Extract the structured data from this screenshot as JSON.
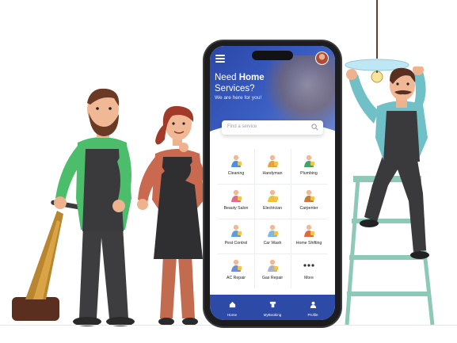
{
  "app": {
    "hero_title_line1_a": "Need ",
    "hero_title_line1_b": "Home",
    "hero_title_line2": "Services?",
    "hero_subtitle": "We are here for you!",
    "search_placeholder": "Find a service"
  },
  "services": [
    {
      "label": "Cleaning",
      "icon": "cleaning-icon"
    },
    {
      "label": "Handyman",
      "icon": "handyman-icon"
    },
    {
      "label": "Plumbing",
      "icon": "plumbing-icon"
    },
    {
      "label": "Beauty Salon",
      "icon": "beauty-salon-icon"
    },
    {
      "label": "Electrician",
      "icon": "electrician-icon"
    },
    {
      "label": "Carpenter",
      "icon": "carpenter-icon"
    },
    {
      "label": "Pest Control",
      "icon": "pest-control-icon"
    },
    {
      "label": "Car Wash",
      "icon": "car-wash-icon"
    },
    {
      "label": "Home Shifting",
      "icon": "home-shifting-icon"
    },
    {
      "label": "AC Repair",
      "icon": "ac-repair-icon"
    },
    {
      "label": "Gas Repair",
      "icon": "gas-repair-icon"
    },
    {
      "label": "More",
      "icon": "more-icon"
    }
  ],
  "bottom_nav": [
    {
      "label": "Home",
      "icon": "home-icon"
    },
    {
      "label": "MyBooking",
      "icon": "booking-icon"
    },
    {
      "label": "Profile",
      "icon": "profile-icon"
    }
  ],
  "colors": {
    "brand_blue": "#2d4aa6",
    "phone_body": "#1d1d1f"
  }
}
